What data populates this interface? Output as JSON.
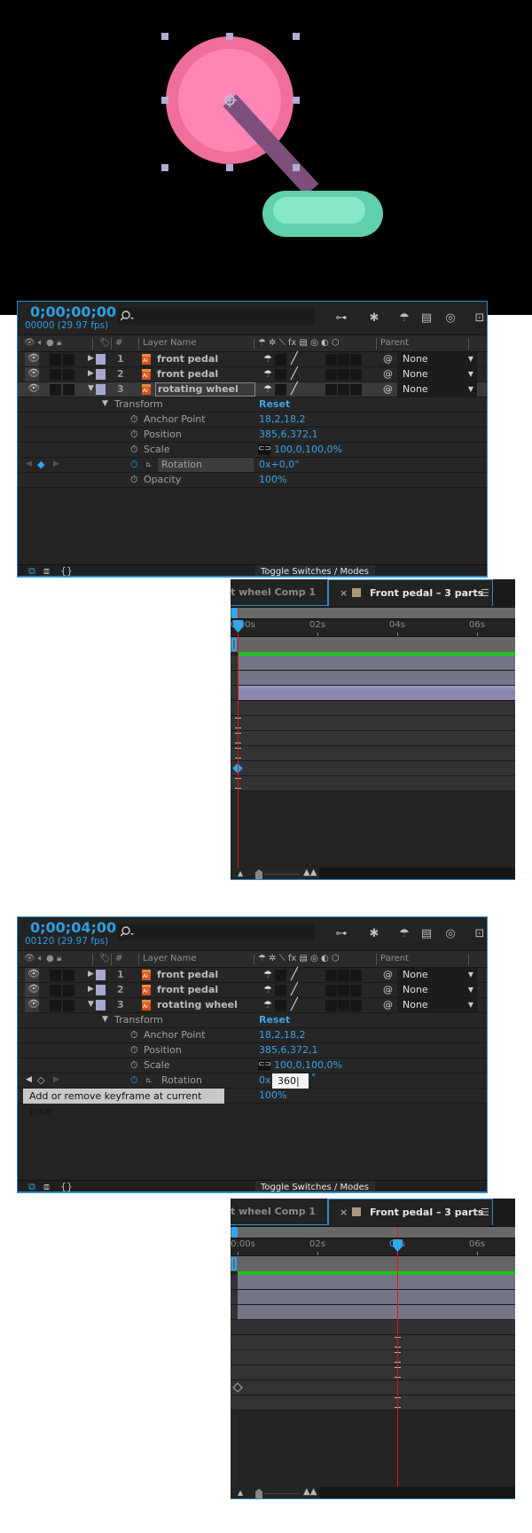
{
  "composition": {
    "background": "#000000",
    "wheel_color": "#f678a3",
    "arm_color": "#7e4f7a",
    "pedal_color": "#66d4b4",
    "handle_color": "#aeaed2"
  },
  "colors": {
    "accent_blue": "#2d9fe0",
    "keyframe_selected": "#2da8ef",
    "work_area_green": "#1fc41f",
    "time_cursor_red": "#e8140c",
    "layer_label_color": "#a7a7cf"
  },
  "panel": {
    "search_icon": "magnifier-icon",
    "header_icons": [
      "comp-flowchart-icon",
      "draft-3d-icon",
      "shy-layers-icon",
      "frame-blending-icon",
      "motion-blur-icon",
      "graph-editor-icon"
    ],
    "columns": {
      "number": "#",
      "layer_name": "Layer Name",
      "parent": "Parent"
    },
    "layers": [
      {
        "number": "1",
        "name": "front pedal",
        "parent": "None"
      },
      {
        "number": "2",
        "name": "front pedal",
        "parent": "None"
      },
      {
        "number": "3",
        "name": "rotating wheel",
        "parent": "None"
      }
    ],
    "transform": {
      "label": "Transform",
      "reset": "Reset"
    },
    "properties": [
      {
        "name": "Anchor Point",
        "value": "18,2,18,2"
      },
      {
        "name": "Position",
        "value": "385,6,372,1"
      },
      {
        "name": "Scale",
        "value": "100,0,100,0%"
      },
      {
        "name": "Rotation",
        "value": ""
      },
      {
        "name": "Opacity",
        "value": "100%"
      }
    ],
    "toggle_label": "Toggle Switches / Modes"
  },
  "timeline": {
    "tabs": [
      {
        "label": "t wheel Comp 1"
      },
      {
        "label": "Front pedal – 3 parts",
        "close": "×",
        "menu": "☰"
      }
    ],
    "ruler_labels": [
      {
        "text": "0:00s",
        "time_s": 0
      },
      {
        "text": "02s",
        "time_s": 2
      },
      {
        "text": "04s",
        "time_s": 4
      },
      {
        "text": "06s",
        "time_s": 6
      }
    ]
  },
  "states": [
    {
      "timecode": "0;00;00;00",
      "frames": "00000 (29.97 fps)",
      "current_time_s": 0,
      "selected_layer": 3,
      "rotation_value": "0x+0,0°",
      "rotation_keyframe_time_s": 0,
      "rotation_keyframe_selected": true
    },
    {
      "timecode": "0;00;04;00",
      "frames": "00120 (29.97 fps)",
      "current_time_s": 4,
      "selected_layer": null,
      "rotation_prefix": "0x",
      "rotation_input": "360",
      "rotation_suffix": "°",
      "tooltip": "Add or remove keyframe at current time",
      "rotation_keyframe_time_s": 0,
      "rotation_keyframe_selected": false
    }
  ]
}
